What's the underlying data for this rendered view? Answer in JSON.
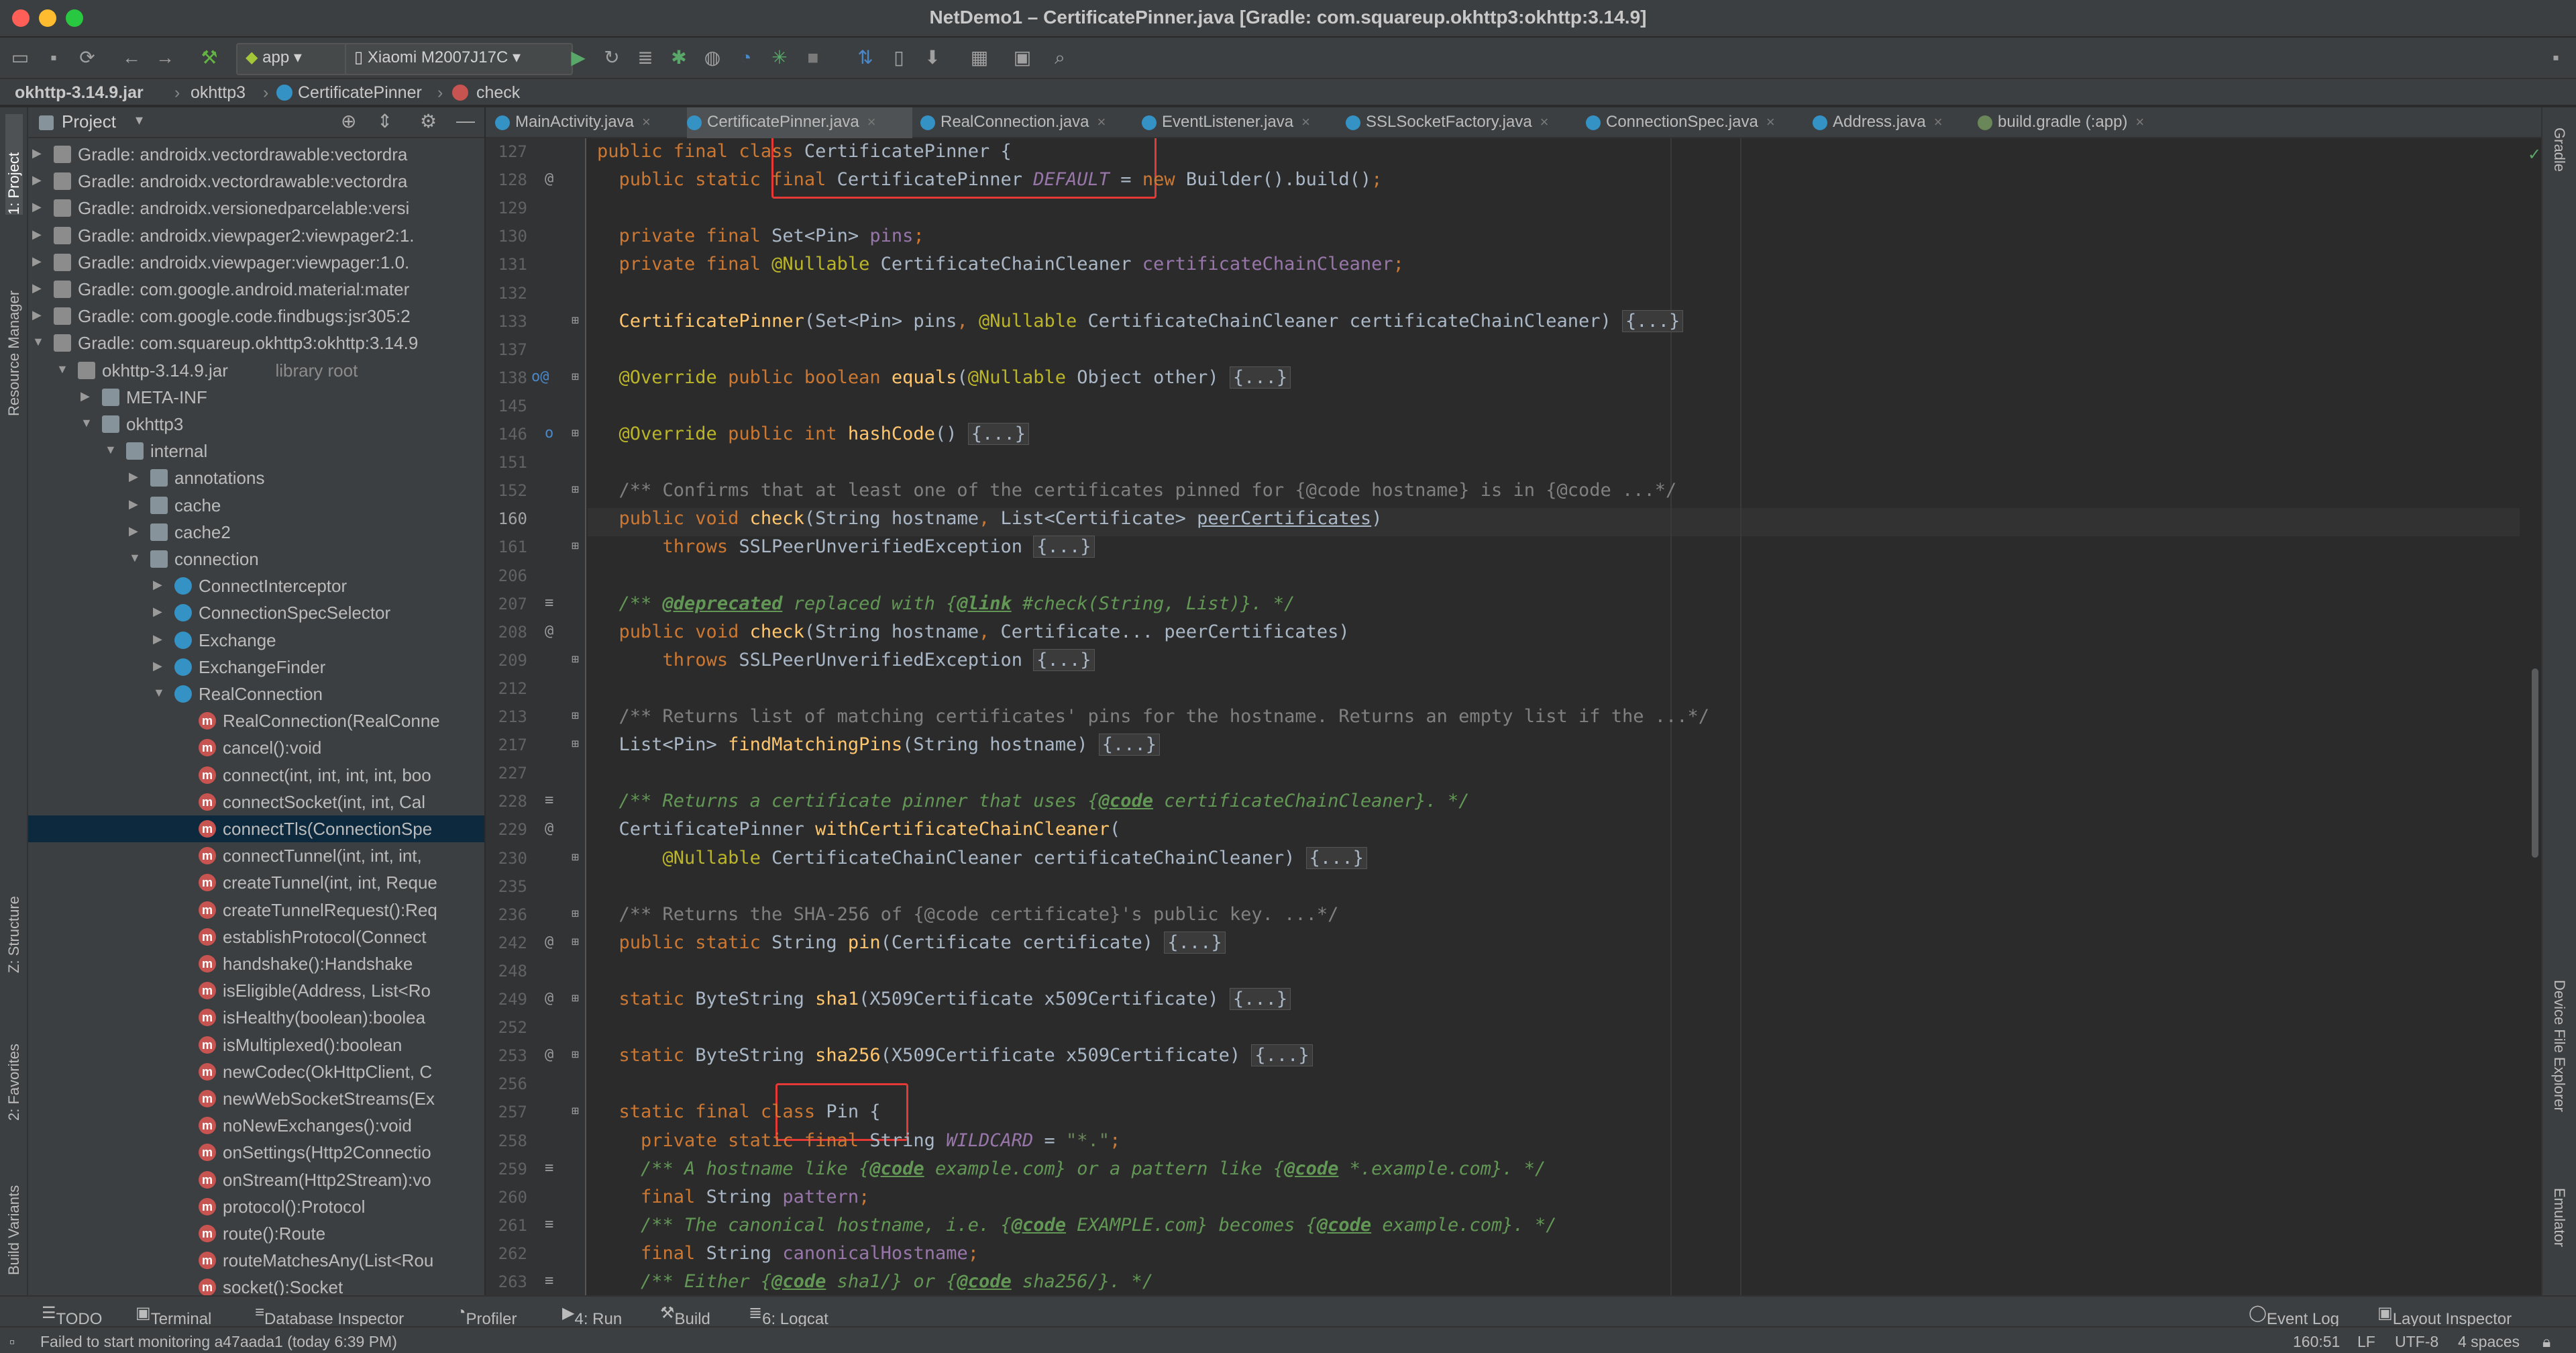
{
  "window": {
    "title": "NetDemo1 – CertificatePinner.java [Gradle: com.squareup.okhttp3:okhttp:3.14.9]"
  },
  "toolbar": {
    "run_config": "app",
    "device": "Xiaomi M2007J17C"
  },
  "breadcrumb": [
    "okhttp-3.14.9.jar",
    "okhttp3",
    "CertificatePinner",
    "check"
  ],
  "left_stripe": [
    "1: Project",
    "Resource Manager",
    "Z: Structure",
    "2: Favorites",
    "Build Variants"
  ],
  "right_stripe": [
    "Gradle",
    "Device File Explorer",
    "Emulator"
  ],
  "project_panel": {
    "title": "Project",
    "rows": [
      {
        "depth": 0,
        "arrow": "▶",
        "icon": "jar",
        "label": "Gradle: androidx.vectordrawable:vectordra"
      },
      {
        "depth": 0,
        "arrow": "▶",
        "icon": "jar",
        "label": "Gradle: androidx.vectordrawable:vectordra"
      },
      {
        "depth": 0,
        "arrow": "▶",
        "icon": "jar",
        "label": "Gradle: androidx.versionedparcelable:versi"
      },
      {
        "depth": 0,
        "arrow": "▶",
        "icon": "jar",
        "label": "Gradle: androidx.viewpager2:viewpager2:1."
      },
      {
        "depth": 0,
        "arrow": "▶",
        "icon": "jar",
        "label": "Gradle: androidx.viewpager:viewpager:1.0."
      },
      {
        "depth": 0,
        "arrow": "▶",
        "icon": "jar",
        "label": "Gradle: com.google.android.material:mater"
      },
      {
        "depth": 0,
        "arrow": "▶",
        "icon": "jar",
        "label": "Gradle: com.google.code.findbugs:jsr305:2"
      },
      {
        "depth": 0,
        "arrow": "▼",
        "icon": "jar",
        "label": "Gradle: com.squareup.okhttp3:okhttp:3.14.9"
      },
      {
        "depth": 1,
        "arrow": "▼",
        "icon": "jar",
        "label": "okhttp-3.14.9.jar",
        "extra": "library root"
      },
      {
        "depth": 2,
        "arrow": "▶",
        "icon": "folder",
        "label": "META-INF"
      },
      {
        "depth": 2,
        "arrow": "▼",
        "icon": "folder",
        "label": "okhttp3"
      },
      {
        "depth": 3,
        "arrow": "▼",
        "icon": "folder",
        "label": "internal"
      },
      {
        "depth": 4,
        "arrow": "▶",
        "icon": "folder",
        "label": "annotations"
      },
      {
        "depth": 4,
        "arrow": "▶",
        "icon": "folder",
        "label": "cache"
      },
      {
        "depth": 4,
        "arrow": "▶",
        "icon": "folder",
        "label": "cache2"
      },
      {
        "depth": 4,
        "arrow": "▼",
        "icon": "folder",
        "label": "connection"
      },
      {
        "depth": 5,
        "arrow": "▶",
        "icon": "cls",
        "label": "ConnectInterceptor"
      },
      {
        "depth": 5,
        "arrow": "▶",
        "icon": "cls",
        "label": "ConnectionSpecSelector"
      },
      {
        "depth": 5,
        "arrow": "▶",
        "icon": "cls",
        "label": "Exchange"
      },
      {
        "depth": 5,
        "arrow": "▶",
        "icon": "cls",
        "label": "ExchangeFinder"
      },
      {
        "depth": 5,
        "arrow": "▼",
        "icon": "cls",
        "label": "RealConnection"
      },
      {
        "depth": 6,
        "arrow": "",
        "icon": "m",
        "label": "RealConnection(RealConne"
      },
      {
        "depth": 6,
        "arrow": "",
        "icon": "m",
        "label": "cancel():void"
      },
      {
        "depth": 6,
        "arrow": "",
        "icon": "m",
        "label": "connect(int, int, int, int, boo"
      },
      {
        "depth": 6,
        "arrow": "",
        "icon": "m",
        "label": "connectSocket(int, int, Cal"
      },
      {
        "depth": 6,
        "arrow": "",
        "icon": "m",
        "label": "connectTls(ConnectionSpe",
        "selected": true
      },
      {
        "depth": 6,
        "arrow": "",
        "icon": "m",
        "label": "connectTunnel(int, int, int,"
      },
      {
        "depth": 6,
        "arrow": "",
        "icon": "m",
        "label": "createTunnel(int, int, Reque"
      },
      {
        "depth": 6,
        "arrow": "",
        "icon": "m",
        "label": "createTunnelRequest():Req"
      },
      {
        "depth": 6,
        "arrow": "",
        "icon": "m",
        "label": "establishProtocol(Connect"
      },
      {
        "depth": 6,
        "arrow": "",
        "icon": "m",
        "label": "handshake():Handshake"
      },
      {
        "depth": 6,
        "arrow": "",
        "icon": "m",
        "label": "isEligible(Address, List<Ro"
      },
      {
        "depth": 6,
        "arrow": "",
        "icon": "m",
        "label": "isHealthy(boolean):boolea"
      },
      {
        "depth": 6,
        "arrow": "",
        "icon": "m",
        "label": "isMultiplexed():boolean"
      },
      {
        "depth": 6,
        "arrow": "",
        "icon": "m",
        "label": "newCodec(OkHttpClient, C"
      },
      {
        "depth": 6,
        "arrow": "",
        "icon": "m",
        "label": "newWebSocketStreams(Ex"
      },
      {
        "depth": 6,
        "arrow": "",
        "icon": "m",
        "label": "noNewExchanges():void"
      },
      {
        "depth": 6,
        "arrow": "",
        "icon": "m",
        "label": "onSettings(Http2Connectio"
      },
      {
        "depth": 6,
        "arrow": "",
        "icon": "m",
        "label": "onStream(Http2Stream):vo"
      },
      {
        "depth": 6,
        "arrow": "",
        "icon": "m",
        "label": "protocol():Protocol"
      },
      {
        "depth": 6,
        "arrow": "",
        "icon": "m",
        "label": "route():Route"
      },
      {
        "depth": 6,
        "arrow": "",
        "icon": "m",
        "label": "routeMatchesAny(List<Rou"
      },
      {
        "depth": 6,
        "arrow": "",
        "icon": "m",
        "label": "socket():Socket"
      }
    ]
  },
  "tabs": [
    {
      "label": "MainActivity.java"
    },
    {
      "label": "CertificatePinner.java",
      "active": true
    },
    {
      "label": "RealConnection.java"
    },
    {
      "label": "EventListener.java"
    },
    {
      "label": "SSLSocketFactory.java"
    },
    {
      "label": "ConnectionSpec.java"
    },
    {
      "label": "Address.java"
    },
    {
      "label": "build.gradle (:app)"
    }
  ],
  "code": {
    "current_line": "160",
    "lines": [
      {
        "n": "127",
        "html": "<span class='kw'>public final class </span>CertificatePinner {"
      },
      {
        "n": "128",
        "mark": "@",
        "html": "  <span class='kw'>public static final </span>CertificatePinner <span class='st'>DEFAULT</span> = <span class='kw'>new </span>Builder().build()<span class='kw'>;</span>"
      },
      {
        "n": "129",
        "html": ""
      },
      {
        "n": "130",
        "html": "  <span class='kw'>private final </span>Set&lt;Pin&gt; <span class='fld'>pins</span><span class='kw'>;</span>"
      },
      {
        "n": "131",
        "html": "  <span class='kw'>private final </span><span class='ann'>@Nullable </span>CertificateChainCleaner <span class='fld'>certificateChainCleaner</span><span class='kw'>;</span>"
      },
      {
        "n": "132",
        "html": ""
      },
      {
        "n": "133",
        "fold": true,
        "html": "  <span class='fn'>CertificatePinner</span>(Set&lt;Pin&gt; pins<span class='kw'>, </span><span class='ann'>@Nullable </span>CertificateChainCleaner certificateChainCleaner) <span class='fold'>{...}</span>"
      },
      {
        "n": "137",
        "html": ""
      },
      {
        "n": "138",
        "mark": "o@",
        "fold": true,
        "html": "  <span class='ann'>@Override </span><span class='kw'>public boolean </span><span class='fn'>equals</span>(<span class='ann'>@Nullable </span>Object other) <span class='fold'>{...}</span>"
      },
      {
        "n": "145",
        "html": ""
      },
      {
        "n": "146",
        "mark": "o",
        "fold": true,
        "html": "  <span class='ann'>@Override </span><span class='kw'>public int </span><span class='fn'>hashCode</span>() <span class='fold'>{...}</span>"
      },
      {
        "n": "151",
        "html": ""
      },
      {
        "n": "152",
        "fold": true,
        "html": "  <span class='cm'>/** Confirms that at least one of the certificates pinned for {@code hostname} is in {@code ...*/</span>"
      },
      {
        "n": "160",
        "html": "  <span class='kw'>public void </span><span class='fn'>check</span>(String hostname<span class='kw'>, </span>List&lt;Certificate&gt; <u>peerCertificates</u>)"
      },
      {
        "n": "161",
        "fold": true,
        "html": "      <span class='kw'>throws </span>SSLPeerUnverifiedException <span class='fold'>{...}</span>"
      },
      {
        "n": "206",
        "html": ""
      },
      {
        "n": "207",
        "mark": "≡",
        "html": "  <span class='jd'>/** </span><span class='jdt'>@deprecated</span><span class='jd'> replaced with {</span><span class='jdt'>@link</span><span class='jd'> #check(String, List)}. */</span>"
      },
      {
        "n": "208",
        "mark": "@",
        "html": "  <span class='kw'>public void </span><span class='fn'>check</span>(String hostname<span class='kw'>, </span>Certificate... peerCertificates)"
      },
      {
        "n": "209",
        "fold": true,
        "html": "      <span class='kw'>throws </span>SSLPeerUnverifiedException <span class='fold'>{...}</span>"
      },
      {
        "n": "212",
        "html": ""
      },
      {
        "n": "213",
        "fold": true,
        "html": "  <span class='cm'>/** Returns list of matching certificates' pins for the hostname. Returns an empty list if the ...*/</span>"
      },
      {
        "n": "217",
        "fold": true,
        "html": "  List&lt;Pin&gt; <span class='fn'>findMatchingPins</span>(String hostname) <span class='fold'>{...}</span>"
      },
      {
        "n": "227",
        "html": ""
      },
      {
        "n": "228",
        "mark": "≡",
        "html": "  <span class='jd'>/** Returns a certificate pinner that uses {</span><span class='jdt'>@code</span><span class='jd'> certificateChainCleaner}. */</span>"
      },
      {
        "n": "229",
        "mark": "@",
        "html": "  CertificatePinner <span class='fn'>withCertificateChainCleaner</span>("
      },
      {
        "n": "230",
        "fold": true,
        "html": "      <span class='ann'>@Nullable </span>CertificateChainCleaner certificateChainCleaner) <span class='fold'>{...}</span>"
      },
      {
        "n": "235",
        "html": ""
      },
      {
        "n": "236",
        "fold": true,
        "html": "  <span class='cm'>/** Returns the SHA-256 of {@code certificate}'s public key. ...*/</span>"
      },
      {
        "n": "242",
        "mark": "@",
        "fold": true,
        "html": "  <span class='kw'>public static </span>String <span class='fn'>pin</span>(Certificate certificate) <span class='fold'>{...}</span>"
      },
      {
        "n": "248",
        "html": ""
      },
      {
        "n": "249",
        "mark": "@",
        "fold": true,
        "html": "  <span class='kw'>static </span>ByteString <span class='fn'>sha1</span>(X509Certificate x509Certificate) <span class='fold'>{...}</span>"
      },
      {
        "n": "252",
        "html": ""
      },
      {
        "n": "253",
        "mark": "@",
        "fold": true,
        "html": "  <span class='kw'>static </span>ByteString <span class='fn'>sha256</span>(X509Certificate x509Certificate) <span class='fold'>{...}</span>"
      },
      {
        "n": "256",
        "html": ""
      },
      {
        "n": "257",
        "fold": true,
        "html": "  <span class='kw'>static final class </span>Pin {"
      },
      {
        "n": "258",
        "html": "    <span class='kw'>private static final </span>String <span class='st'>WILDCARD </span>= <span class='str'>\"*.\"</span><span class='kw'>;</span>"
      },
      {
        "n": "259",
        "mark": "≡",
        "html": "    <span class='jd'>/** A hostname like {</span><span class='jdt'>@code</span><span class='jd'> example.com} or a pattern like {</span><span class='jdt'>@code</span><span class='jd'> *.example.com}. */</span>"
      },
      {
        "n": "260",
        "html": "    <span class='kw'>final </span>String <span class='fld'>pattern</span><span class='kw'>;</span>"
      },
      {
        "n": "261",
        "mark": "≡",
        "html": "    <span class='jd'>/** The canonical hostname, i.e. {</span><span class='jdt'>@code</span><span class='jd'> EXAMPLE.com} becomes {</span><span class='jdt'>@code</span><span class='jd'> example.com}. */</span>"
      },
      {
        "n": "262",
        "html": "    <span class='kw'>final </span>String <span class='fld'>canonicalHostname</span><span class='kw'>;</span>"
      },
      {
        "n": "263",
        "mark": "≡",
        "html": "    <span class='jd'>/** Either {</span><span class='jdt'>@code</span><span class='jd'> sha1/} or {</span><span class='jdt'>@code</span><span class='jd'> sha256/}. */</span>"
      }
    ]
  },
  "bottom_tools": [
    "TODO",
    "Terminal",
    "Database Inspector",
    "Profiler",
    "4: Run",
    "Build",
    "6: Logcat"
  ],
  "bottom_right_tools": [
    "Event Log",
    "Layout Inspector"
  ],
  "status": {
    "message": "Failed to start monitoring a47aada1 (today 6:39 PM)",
    "position": "160:51",
    "line_sep": "LF",
    "encoding": "UTF-8",
    "indent": "4 spaces"
  },
  "colors": {
    "traffic_close": "#ff5f57",
    "traffic_min": "#febc2e",
    "traffic_max": "#28c840",
    "highlight_box": "#e53935",
    "accent": "#4a88c7"
  }
}
